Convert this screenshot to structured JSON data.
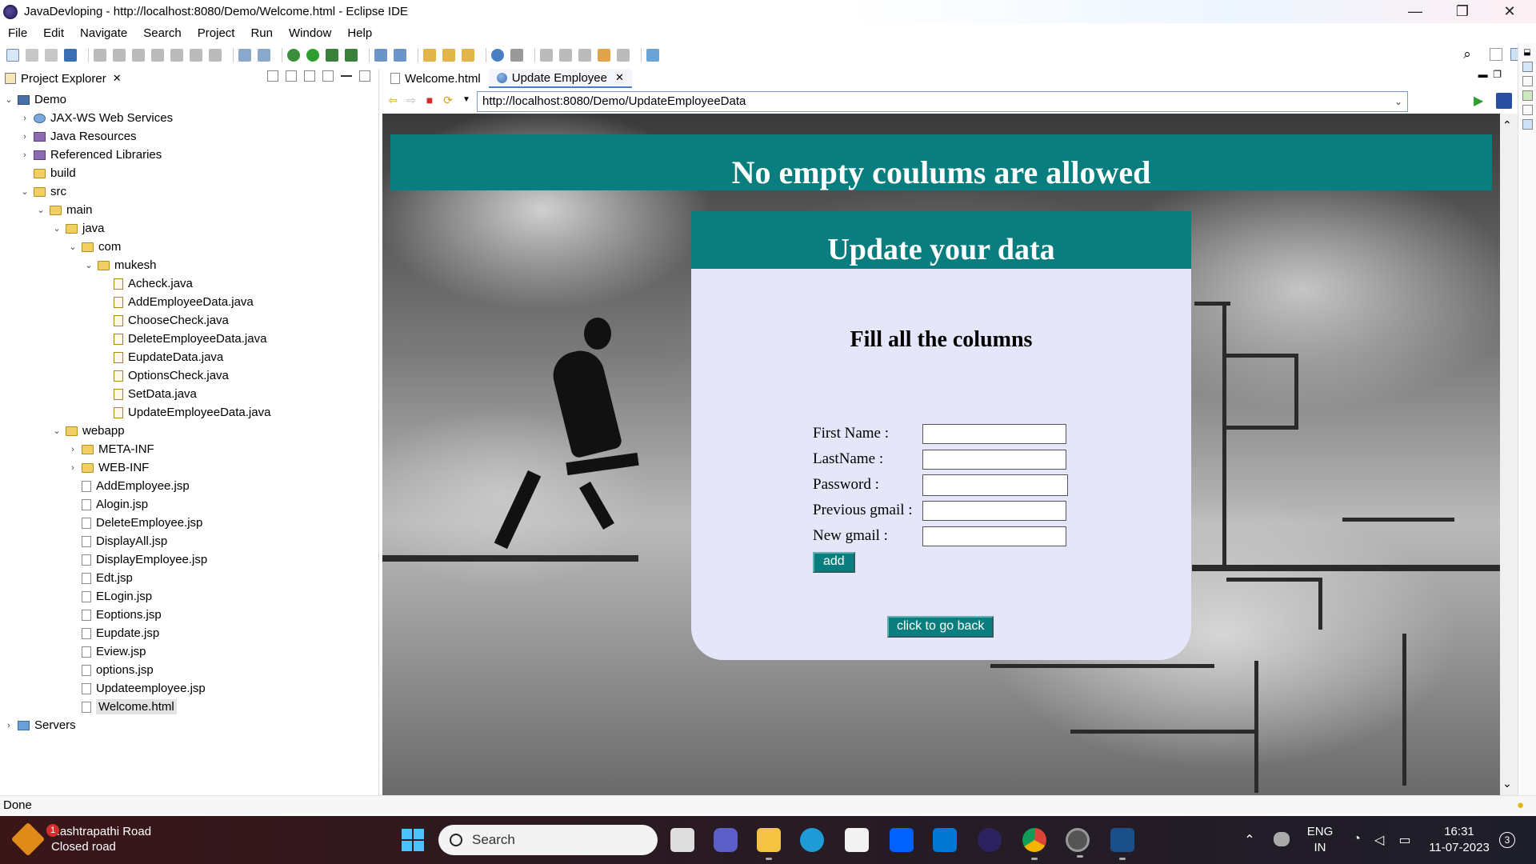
{
  "window": {
    "title": "JavaDevloping - http://localhost:8080/Demo/Welcome.html - Eclipse IDE",
    "controls": {
      "minimize": "—",
      "restore": "❐",
      "close": "✕"
    }
  },
  "menu": [
    "File",
    "Edit",
    "Navigate",
    "Search",
    "Project",
    "Run",
    "Window",
    "Help"
  ],
  "project_explorer": {
    "tab_label": "Project Explorer",
    "tree": [
      {
        "label": "Demo",
        "depth": 0,
        "toggle": "v",
        "icon": "project-icon"
      },
      {
        "label": "JAX-WS Web Services",
        "depth": 1,
        "toggle": ">",
        "icon": "webservices-icon"
      },
      {
        "label": "Java Resources",
        "depth": 1,
        "toggle": ">",
        "icon": "java-resources-icon"
      },
      {
        "label": "Referenced Libraries",
        "depth": 1,
        "toggle": ">",
        "icon": "library-icon"
      },
      {
        "label": "build",
        "depth": 1,
        "toggle": "",
        "icon": "folder-icon"
      },
      {
        "label": "src",
        "depth": 1,
        "toggle": "v",
        "icon": "folder-icon"
      },
      {
        "label": "main",
        "depth": 2,
        "toggle": "v",
        "icon": "folder-icon"
      },
      {
        "label": "java",
        "depth": 3,
        "toggle": "v",
        "icon": "folder-icon"
      },
      {
        "label": "com",
        "depth": 4,
        "toggle": "v",
        "icon": "folder-icon"
      },
      {
        "label": "mukesh",
        "depth": 5,
        "toggle": "v",
        "icon": "folder-icon"
      },
      {
        "label": "Acheck.java",
        "depth": 6,
        "toggle": "",
        "icon": "java-file-icon"
      },
      {
        "label": "AddEmployeeData.java",
        "depth": 6,
        "toggle": "",
        "icon": "java-file-icon"
      },
      {
        "label": "ChooseCheck.java",
        "depth": 6,
        "toggle": "",
        "icon": "java-file-icon"
      },
      {
        "label": "DeleteEmployeeData.java",
        "depth": 6,
        "toggle": "",
        "icon": "java-file-icon"
      },
      {
        "label": "EupdateData.java",
        "depth": 6,
        "toggle": "",
        "icon": "java-file-icon"
      },
      {
        "label": "OptionsCheck.java",
        "depth": 6,
        "toggle": "",
        "icon": "java-file-icon"
      },
      {
        "label": "SetData.java",
        "depth": 6,
        "toggle": "",
        "icon": "java-file-icon"
      },
      {
        "label": "UpdateEmployeeData.java",
        "depth": 6,
        "toggle": "",
        "icon": "java-file-icon"
      },
      {
        "label": "webapp",
        "depth": 3,
        "toggle": "v",
        "icon": "folder-icon"
      },
      {
        "label": "META-INF",
        "depth": 4,
        "toggle": ">",
        "icon": "folder-icon"
      },
      {
        "label": "WEB-INF",
        "depth": 4,
        "toggle": ">",
        "icon": "folder-icon"
      },
      {
        "label": "AddEmployee.jsp",
        "depth": 4,
        "toggle": "",
        "icon": "jsp-file-icon"
      },
      {
        "label": "Alogin.jsp",
        "depth": 4,
        "toggle": "",
        "icon": "jsp-file-icon"
      },
      {
        "label": "DeleteEmployee.jsp",
        "depth": 4,
        "toggle": "",
        "icon": "jsp-file-icon"
      },
      {
        "label": "DisplayAll.jsp",
        "depth": 4,
        "toggle": "",
        "icon": "jsp-file-icon"
      },
      {
        "label": "DisplayEmployee.jsp",
        "depth": 4,
        "toggle": "",
        "icon": "jsp-file-icon"
      },
      {
        "label": "Edt.jsp",
        "depth": 4,
        "toggle": "",
        "icon": "jsp-file-icon"
      },
      {
        "label": "ELogin.jsp",
        "depth": 4,
        "toggle": "",
        "icon": "jsp-file-icon"
      },
      {
        "label": "Eoptions.jsp",
        "depth": 4,
        "toggle": "",
        "icon": "jsp-file-icon"
      },
      {
        "label": "Eupdate.jsp",
        "depth": 4,
        "toggle": "",
        "icon": "jsp-file-icon"
      },
      {
        "label": "Eview.jsp",
        "depth": 4,
        "toggle": "",
        "icon": "jsp-file-icon"
      },
      {
        "label": "options.jsp",
        "depth": 4,
        "toggle": "",
        "icon": "jsp-file-icon"
      },
      {
        "label": "Updateemployee.jsp",
        "depth": 4,
        "toggle": "",
        "icon": "jsp-file-icon"
      },
      {
        "label": "Welcome.html",
        "depth": 4,
        "toggle": "",
        "icon": "html-file-icon",
        "selected": true
      },
      {
        "label": "Servers",
        "depth": 0,
        "toggle": ">",
        "icon": "servers-folder-icon"
      }
    ]
  },
  "editor": {
    "tabs": [
      {
        "label": "Welcome.html",
        "active": false
      },
      {
        "label": "Update Employee",
        "active": true
      }
    ],
    "url": "http://localhost:8080/Demo/UpdateEmployeeData"
  },
  "page": {
    "banner": "No empty coulums are allowed",
    "card_title": "Update your data",
    "subtitle": "Fill all the columns",
    "fields": [
      {
        "label": "First Name :",
        "value": ""
      },
      {
        "label": "LastName :",
        "value": ""
      },
      {
        "label": "Password :",
        "value": ""
      },
      {
        "label": "Previous gmail :",
        "value": ""
      },
      {
        "label": "New gmail :",
        "value": ""
      }
    ],
    "add_button": "add",
    "back_button": "click to go back",
    "colors": {
      "teal": "#0a7e7e",
      "card": "#e6e6fa"
    }
  },
  "status_bar": {
    "text": "Done"
  },
  "taskbar": {
    "weather": {
      "title": "Rashtrapathi Road",
      "subtitle": "Closed road",
      "badge": "1"
    },
    "search_placeholder": "Search",
    "language": {
      "line1": "ENG",
      "line2": "IN"
    },
    "clock": {
      "time": "16:31",
      "date": "11-07-2023"
    },
    "notification_count": "3"
  }
}
